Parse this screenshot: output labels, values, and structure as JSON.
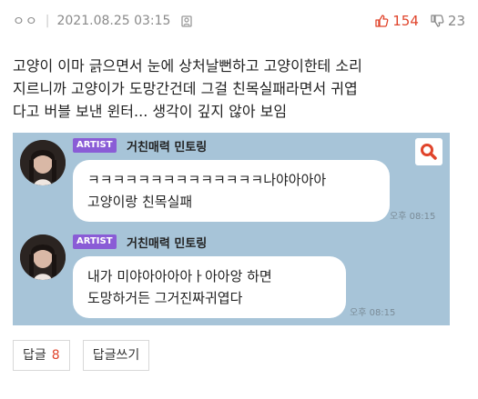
{
  "meta": {
    "nickname": "ㅇㅇ",
    "separator": "|",
    "datetime": "2021.08.25 03:15",
    "upvotes": "154",
    "downvotes": "23",
    "colors": {
      "upvote": "#e0442b",
      "downvote": "#888888"
    }
  },
  "body": {
    "lines": [
      "고양이 이마 긁으면서 눈에 상처날뻔하고 고양이한테 소리",
      "지르니까 고양이가 도망간건데 그걸 친목실패라면서 귀엽",
      "다고 버블 보낸 윈터... 생각이 깊지 않아 보임"
    ]
  },
  "chat": {
    "messages": [
      {
        "tag": "ARTIST",
        "sender": "거친매력 민토링",
        "lines": [
          "ㅋㅋㅋㅋㅋㅋㅋㅋㅋㅋㅋㅋㅋㅋ나야아아아",
          "고양이랑 친목실패"
        ],
        "time": "오후 08:15"
      },
      {
        "tag": "ARTIST",
        "sender": "거친매력 민토링",
        "lines": [
          "내가 미야아아아아ㅏ아아앙 하면",
          "도망하거든 그거진짜귀엽다"
        ],
        "time": "오후 08:15"
      }
    ],
    "colors": {
      "background": "#a7c4d8",
      "tag": "#8a5cd6",
      "search_icon": "#e0442b"
    }
  },
  "buttons": {
    "reply_label": "답글",
    "reply_count": "8",
    "write_reply_label": "답글쓰기"
  }
}
